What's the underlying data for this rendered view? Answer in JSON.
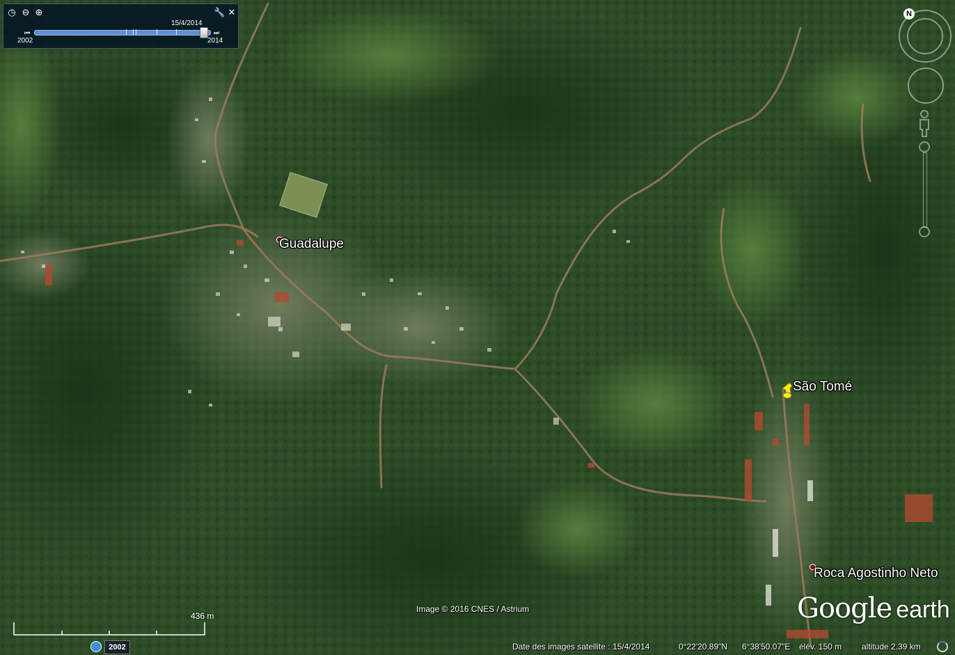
{
  "time_slider": {
    "current_date": "15/4/2014",
    "start_year": "2002",
    "end_year": "2014",
    "value": 0.96
  },
  "places": [
    {
      "name": "Guadalupe"
    },
    {
      "name": "São Tomé"
    },
    {
      "name": "Roca Agostinho Neto"
    }
  ],
  "scale_bar": {
    "label": "436  m"
  },
  "historical_badge": "2002",
  "credit": "Image © 2016 CNES / Astrium",
  "logo": {
    "word1": "Google",
    "word2": "earth"
  },
  "status_bar": {
    "imagery_date": "Date des images satellite : 15/4/2014",
    "latitude": "0°22'20.89\"N",
    "longitude": "6°38'50.07\"E",
    "elevation": "élév.   150 m",
    "altitude": "altitude    2.39 km"
  },
  "colors": {
    "forest_dark": "#1f3a1c",
    "forest": "#2f5128",
    "clearing": "#4f7a3a",
    "road": "#9c7a5a",
    "pin_yellow": "#f2e82a",
    "pin_red": "#8b0f17"
  }
}
